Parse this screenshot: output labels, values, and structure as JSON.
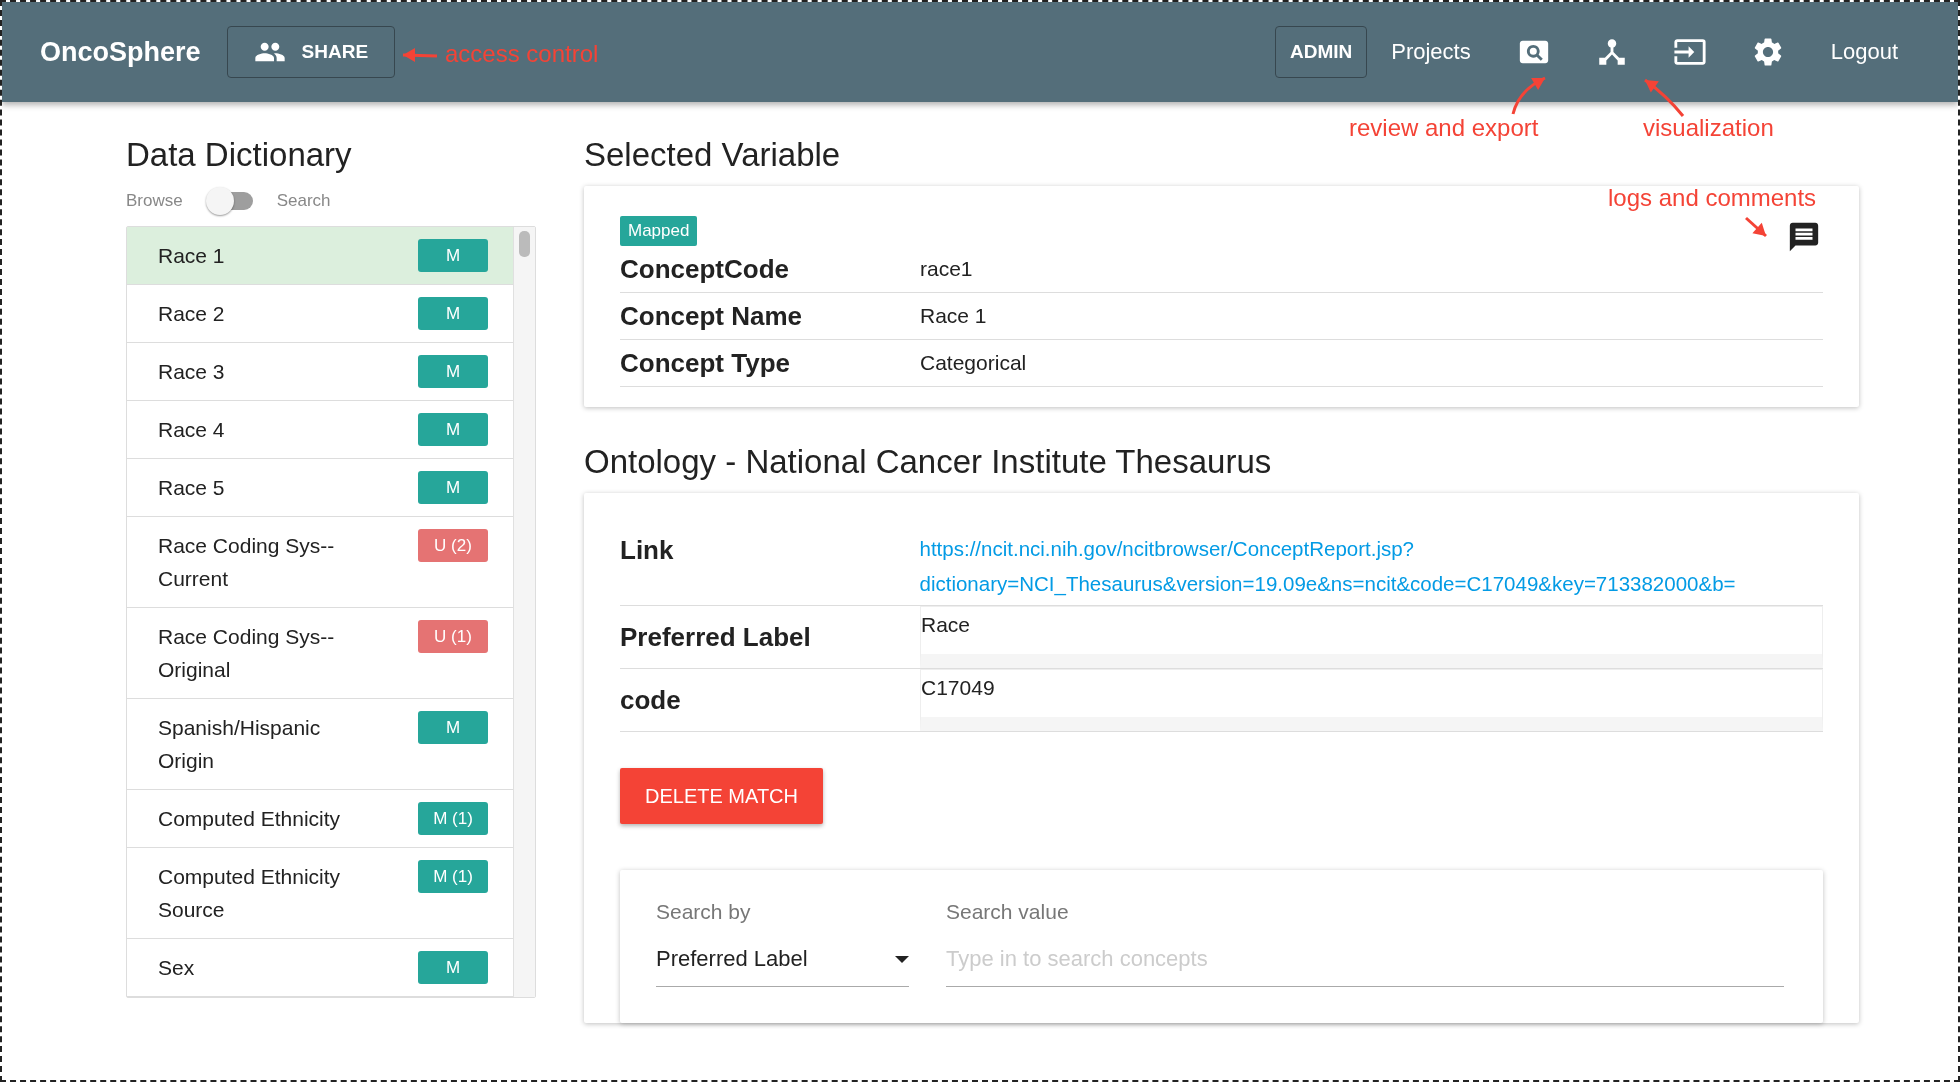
{
  "header": {
    "brand": "OncoSphere",
    "share_button": "SHARE",
    "admin_button": "ADMIN",
    "projects_link": "Projects",
    "logout_link": "Logout"
  },
  "dictionary": {
    "title": "Data Dictionary",
    "toggle": {
      "left_label": "Browse",
      "right_label": "Search",
      "on": false
    },
    "items": [
      {
        "name": "Race 1",
        "badge": "M",
        "color": "#26a69a",
        "selected": true
      },
      {
        "name": "Race 2",
        "badge": "M",
        "color": "#26a69a",
        "selected": false
      },
      {
        "name": "Race 3",
        "badge": "M",
        "color": "#26a69a",
        "selected": false
      },
      {
        "name": "Race 4",
        "badge": "M",
        "color": "#26a69a",
        "selected": false
      },
      {
        "name": "Race 5",
        "badge": "M",
        "color": "#26a69a",
        "selected": false
      },
      {
        "name": "Race Coding Sys--Current",
        "badge": "U (2)",
        "color": "#e57373",
        "selected": false
      },
      {
        "name": "Race Coding Sys--Original",
        "badge": "U (1)",
        "color": "#e57373",
        "selected": false
      },
      {
        "name": "Spanish/Hispanic Origin",
        "badge": "M",
        "color": "#26a69a",
        "selected": false
      },
      {
        "name": "Computed Ethnicity",
        "badge": "M (1)",
        "color": "#26a69a",
        "selected": false
      },
      {
        "name": "Computed Ethnicity Source",
        "badge": "M (1)",
        "color": "#26a69a",
        "selected": false
      },
      {
        "name": "Sex",
        "badge": "M",
        "color": "#26a69a",
        "selected": false
      }
    ]
  },
  "selected_variable": {
    "title": "Selected Variable",
    "status": "Mapped",
    "rows": [
      {
        "label": "ConceptCode",
        "value": "race1"
      },
      {
        "label": "Concept Name",
        "value": "Race 1"
      },
      {
        "label": "Concept Type",
        "value": "Categorical"
      }
    ]
  },
  "ontology": {
    "title": "Ontology - National Cancer Institute Thesaurus",
    "link_label": "Link",
    "link_lines": [
      "https://ncit.nci.nih.gov/ncitbrowser/ConceptReport.jsp?",
      "dictionary=NCI_Thesaurus&version=19.09e&ns=ncit&code=C17049&key=713382000&b="
    ],
    "fields": [
      {
        "label": "Preferred Label",
        "value": "Race"
      },
      {
        "label": "code",
        "value": "C17049"
      }
    ],
    "delete_button": "DELETE MATCH",
    "search": {
      "by_label": "Search by",
      "by_value": "Preferred Label",
      "value_label": "Search value",
      "placeholder": "Type in to search concepts"
    }
  },
  "annotations": [
    {
      "text": "access control"
    },
    {
      "text": "review and export"
    },
    {
      "text": "visualization"
    },
    {
      "text": "logs and comments"
    }
  ]
}
